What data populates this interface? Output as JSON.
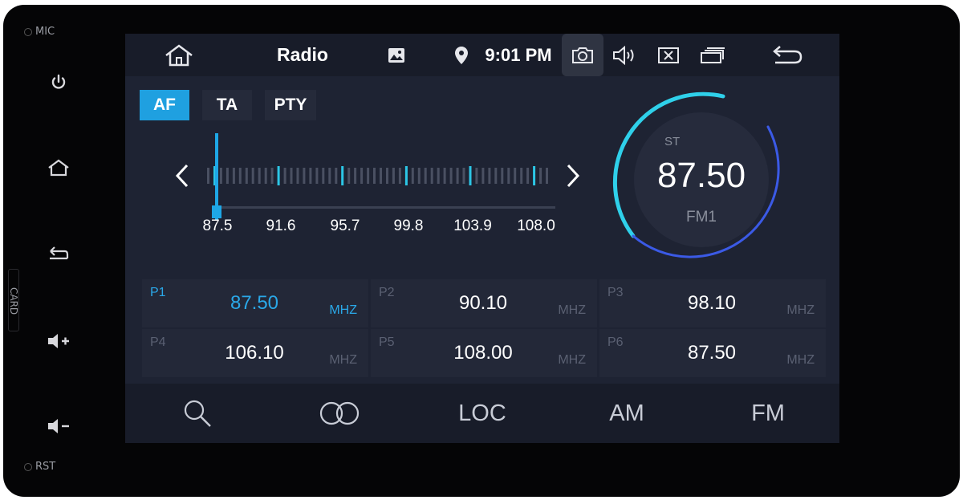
{
  "hardware": {
    "mic_label": "MIC",
    "rst_label": "RST",
    "card_label": "CARD",
    "buttons": [
      "power-icon",
      "home-icon",
      "back-icon",
      "volume-up-icon",
      "volume-down-icon"
    ]
  },
  "statusbar": {
    "title": "Radio",
    "time": "9:01 PM",
    "icons": [
      "home-icon",
      "image-icon",
      "location-pin-icon",
      "camera-icon",
      "volume-icon",
      "close-box-icon",
      "windows-icon",
      "return-icon"
    ]
  },
  "rds": {
    "buttons": [
      {
        "label": "AF",
        "active": true
      },
      {
        "label": "TA",
        "active": false
      },
      {
        "label": "PTY",
        "active": false
      }
    ]
  },
  "tuner": {
    "scale_labels": [
      "87.5",
      "91.6",
      "95.7",
      "99.8",
      "103.9",
      "108.0"
    ],
    "current_position_fraction": 0.0
  },
  "dial": {
    "stereo": "ST",
    "frequency": "87.50",
    "band": "FM1"
  },
  "presets": [
    {
      "name": "P1",
      "freq": "87.50",
      "unit": "MHZ",
      "selected": true
    },
    {
      "name": "P2",
      "freq": "90.10",
      "unit": "MHZ",
      "selected": false
    },
    {
      "name": "P3",
      "freq": "98.10",
      "unit": "MHZ",
      "selected": false
    },
    {
      "name": "P4",
      "freq": "106.10",
      "unit": "MHZ",
      "selected": false
    },
    {
      "name": "P5",
      "freq": "108.00",
      "unit": "MHZ",
      "selected": false
    },
    {
      "name": "P6",
      "freq": "87.50",
      "unit": "MHZ",
      "selected": false
    }
  ],
  "bottombar": {
    "search_icon": "search-icon",
    "stereo_icon": "stereo-circles-icon",
    "loc": "LOC",
    "am": "AM",
    "fm": "FM"
  },
  "colors": {
    "accent": "#1fa0e0",
    "screen_bg": "#1e2333",
    "bar_bg": "#181c29"
  }
}
